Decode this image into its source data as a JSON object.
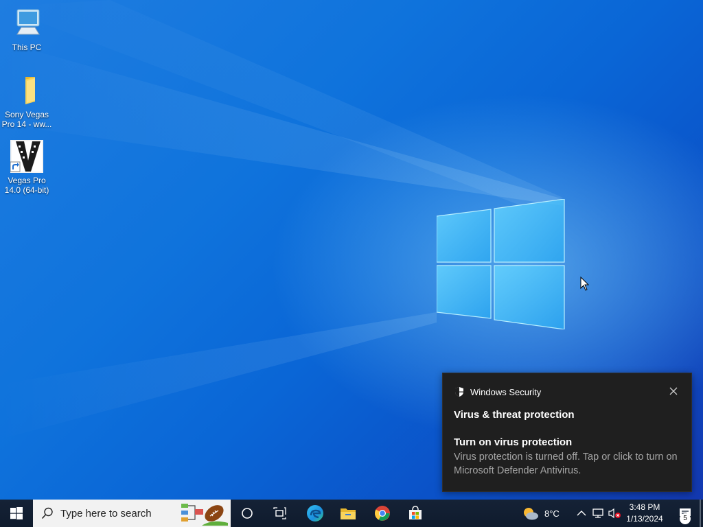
{
  "desktop": {
    "icons": [
      {
        "label": "This PC",
        "icon": "this-pc-icon"
      },
      {
        "label": "Sony Vegas Pro 14 - ww...",
        "icon": "folder-icon"
      },
      {
        "label": "Vegas Pro 14.0 (64-bit)",
        "icon": "vegas-pro-icon"
      }
    ]
  },
  "toast": {
    "app_name": "Windows Security",
    "title": "Virus & threat protection",
    "subtitle": "Turn on virus protection",
    "body": "Virus protection is turned off. Tap or click to turn on Microsoft Defender Antivirus."
  },
  "taskbar": {
    "search_placeholder": "Type here to search",
    "pinned": [
      "task-view-icon",
      "edge-icon",
      "file-explorer-icon",
      "chrome-icon",
      "microsoft-store-icon"
    ],
    "weather": {
      "temp": "8°C",
      "icon": "partly-cloudy-icon"
    },
    "clock": {
      "time": "3:48 PM",
      "date": "1/13/2024"
    },
    "notification_count": "5"
  },
  "colors": {
    "accent": "#0078d7",
    "taskbar": "#0f1b2d",
    "toast_bg": "#1f1f1f"
  }
}
